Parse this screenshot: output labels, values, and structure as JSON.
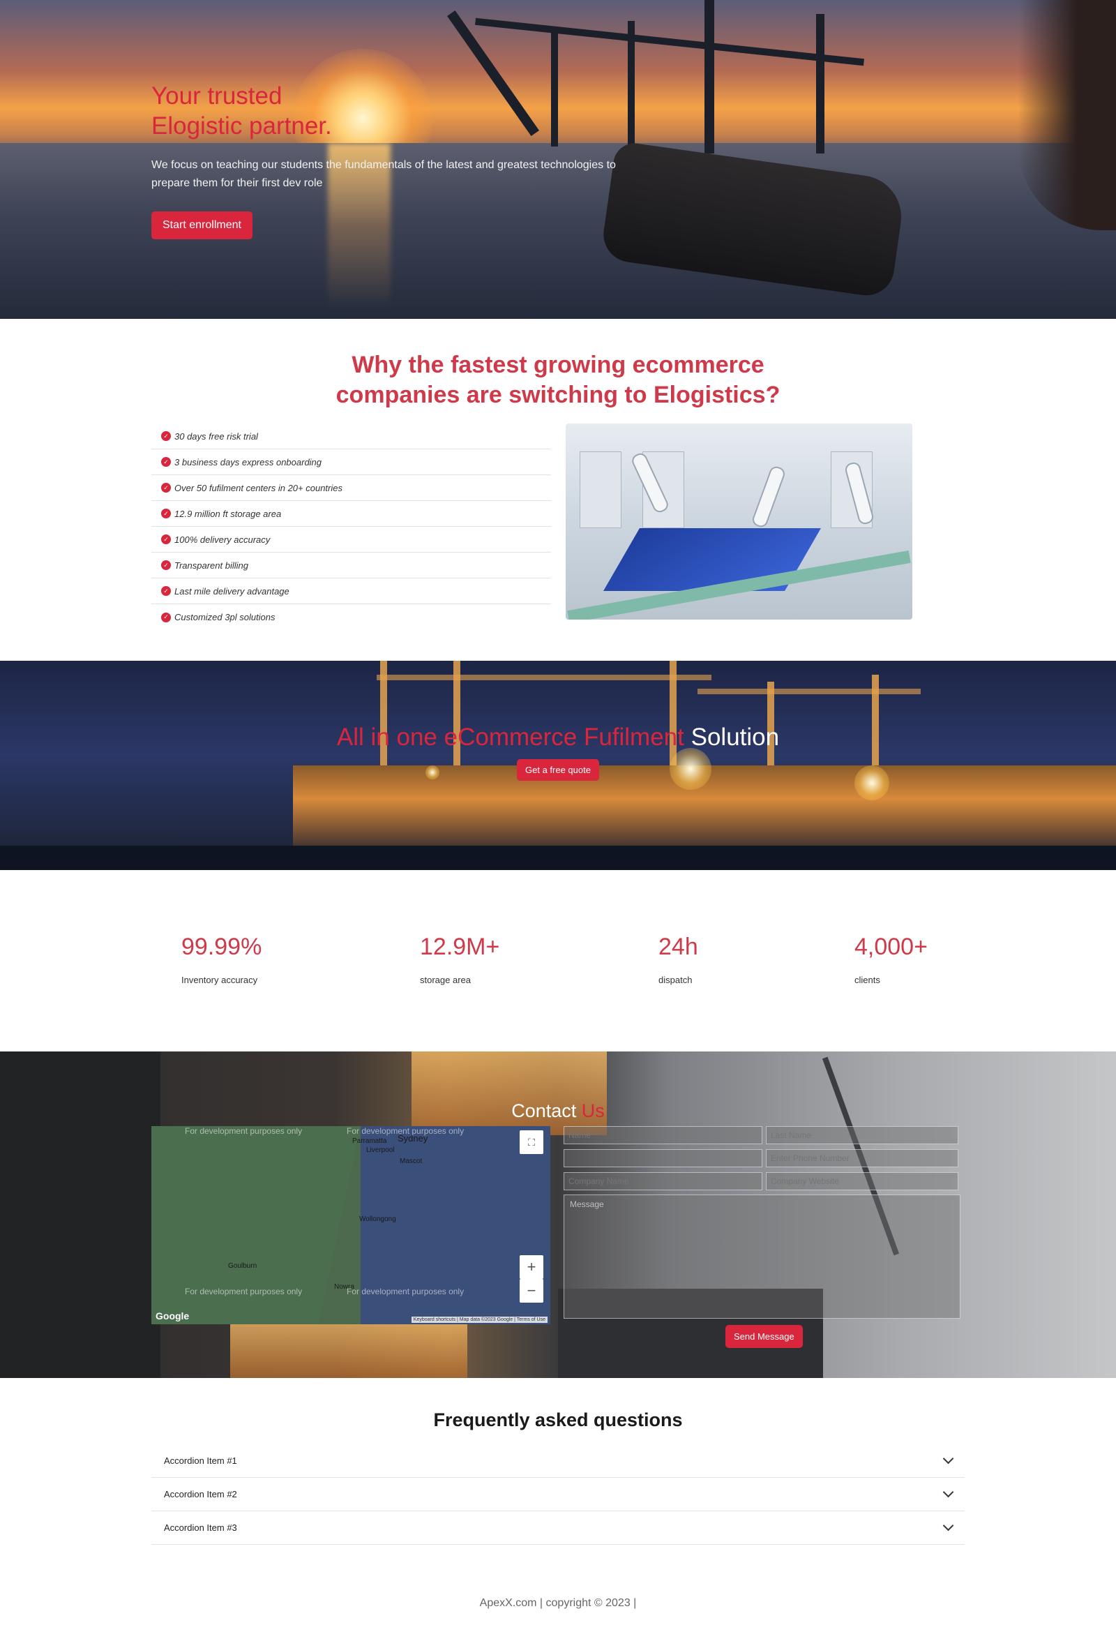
{
  "hero": {
    "title": "Your trusted\nElogistic partner.",
    "subtitle": "We focus on teaching our students the fundamentals of the latest and greatest technologies to prepare them for their first dev role",
    "cta": "Start enrollment"
  },
  "why": {
    "title": "Why the fastest growing ecommerce\ncompanies are switching to Elogistics?",
    "items": [
      "30 days free risk trial",
      "3 business days express onboarding",
      "Over 50 fufilment centers in 20+ countries",
      "12.9 million ft storage area",
      "100% delivery accuracy",
      "Transparent billing",
      "Last mile delivery advantage",
      "Customized 3pl solutions"
    ]
  },
  "banner": {
    "title_red": "All in one eCommerce Fufilment",
    "title_white": "Solution",
    "cta": "Get a free quote"
  },
  "stats": [
    {
      "value": "99.99%",
      "label": "Inventory accuracy"
    },
    {
      "value": "12.9M+",
      "label": "storage area"
    },
    {
      "value": "24h",
      "label": "dispatch"
    },
    {
      "value": "4,000+",
      "label": "clients"
    }
  ],
  "contact": {
    "title_white": "Contact",
    "title_red": "Us",
    "map": {
      "dev_notice": "For development purposes only",
      "cities": [
        "Sydney",
        "Parramatta",
        "Liverpool",
        "Mascot",
        "Wollongong",
        "Goulburn",
        "Nowra"
      ],
      "google": "Google",
      "attribution": "Keyboard shortcuts | Map data ©2023 Google | Terms of Use",
      "fullscreen_icon": "fullscreen-icon",
      "zoom_in": "+",
      "zoom_out": "−"
    },
    "fields": {
      "first_name": "Name",
      "last_name": "Last Name",
      "email": "",
      "phone": "Enter Phone Number",
      "company": "Company Name",
      "website": "Company Website",
      "message": "Message"
    },
    "send": "Send Message"
  },
  "faq": {
    "title": "Frequently asked questions",
    "items": [
      "Accordion Item #1",
      "Accordion Item #2",
      "Accordion Item #3"
    ]
  },
  "footer": "ApexX.com | copyright © 2023 |",
  "colors": {
    "accent": "#d9263d",
    "heading_red": "#cf3a4a"
  }
}
